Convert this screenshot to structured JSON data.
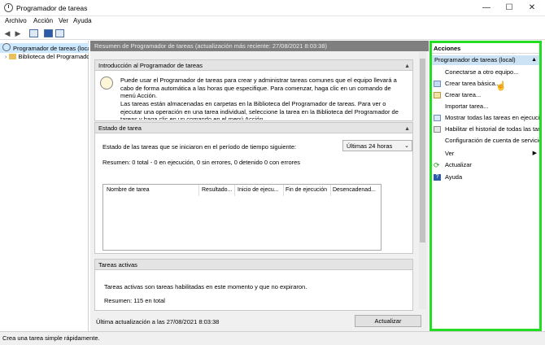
{
  "window": {
    "title": "Programador de tareas"
  },
  "menu": [
    "Archivo",
    "Acción",
    "Ver",
    "Ayuda"
  ],
  "tree": {
    "root": "Programador de tareas (local)",
    "child": "Biblioteca del Programador de tareas"
  },
  "center": {
    "header": "Resumen de Programador de tareas (actualización más reciente: 27/08/2021 8:03:38)",
    "intro": {
      "title": "Introducción al Programador de tareas",
      "p1": "Puede usar el Programador de tareas para crear y administrar tareas comunes que el equipo llevará a cabo de forma automática a las horas que especifique. Para comenzar, haga clic en un comando de menú Acción.",
      "p2": "Las tareas están almacenadas en carpetas en la Biblioteca del Programador de tareas. Para ver o ejecutar una operación en una tarea individual, seleccione la tarea en la Biblioteca del Programador de tareas y haga clic en un comando en el menú Acción."
    },
    "status": {
      "title": "Estado de tarea",
      "label": "Estado de las tareas que se iniciaron en el período de tiempo siguiente:",
      "period": "Últimas 24 horas",
      "summary": "Resumen: 0 total - 0 en ejecución, 0 sin errores, 0 detenido 0 con errores",
      "columns": [
        "Nombre de tarea",
        "Resultado...",
        "Inicio de ejecu...",
        "Fin de ejecución",
        "Desencadenad..."
      ]
    },
    "active": {
      "title": "Tareas activas",
      "text": "Tareas activas son tareas habilitadas en este momento y que no expiraron.",
      "summary": "Resumen: 115 en total"
    },
    "footer": {
      "last_update": "Última actualización a las 27/08/2021 8:03:38",
      "refresh_btn": "Actualizar"
    }
  },
  "actions": {
    "header": "Acciones",
    "subheader": "Programador de tareas (local)",
    "items": [
      "Conectarse a otro equipo...",
      "Crear tarea básica...",
      "Crear tarea...",
      "Importar tarea...",
      "Mostrar todas las tareas en ejecución",
      "Habilitar el historial de todas las tareas",
      "Configuración de cuenta de servicio AT",
      "Ver",
      "Actualizar",
      "Ayuda"
    ]
  },
  "statusbar": "Crea una tarea simple rápidamente."
}
